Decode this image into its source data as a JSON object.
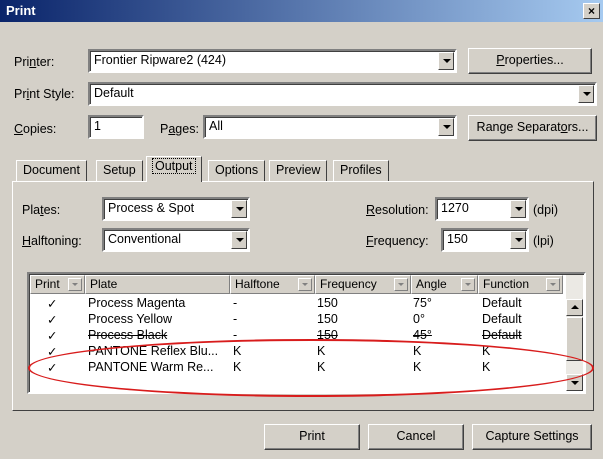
{
  "window": {
    "title": "Print",
    "close_glyph": "×"
  },
  "printer": {
    "label_pre": "Pri",
    "label_u": "n",
    "label_post": "ter:",
    "value": "Frontier Ripware2 (424)",
    "properties_pre": "",
    "properties_u": "P",
    "properties_post": "roperties..."
  },
  "print_style": {
    "label_pre": "Pr",
    "label_u": "i",
    "label_post": "nt Style:",
    "value": "Default"
  },
  "copies": {
    "label_pre": "",
    "label_u": "C",
    "label_post": "opies:",
    "value": "1"
  },
  "pages": {
    "label_pre": "P",
    "label_u": "a",
    "label_post": "ges:",
    "value": "All",
    "range_pre": "Range Separat",
    "range_u": "o",
    "range_post": "rs..."
  },
  "tabs": [
    {
      "label": "Document"
    },
    {
      "label": "Setup"
    },
    {
      "label": "Output",
      "active": true
    },
    {
      "label": "Options"
    },
    {
      "label": "Preview"
    },
    {
      "label": "Profiles"
    }
  ],
  "output": {
    "plates": {
      "label_pre": "Pla",
      "label_u": "t",
      "label_post": "es:",
      "value": "Process & Spot"
    },
    "halftoning": {
      "label_pre": "",
      "label_u": "H",
      "label_post": "alftoning:",
      "value": "Conventional"
    },
    "resolution": {
      "label_pre": "",
      "label_u": "R",
      "label_post": "esolution:",
      "value": "1270",
      "unit": "(dpi)"
    },
    "frequency": {
      "label_pre": "",
      "label_u": "F",
      "label_post": "requency:",
      "value": "150",
      "unit": "(lpi)"
    }
  },
  "table": {
    "headers": [
      "Print",
      "Plate",
      "Halftone",
      "Frequency",
      "Angle",
      "Function"
    ],
    "rows": [
      {
        "print": "✓",
        "plate": "Process Magenta",
        "halftone": "-",
        "frequency": "150",
        "angle": "75°",
        "function": "Default"
      },
      {
        "print": "✓",
        "plate": "Process Yellow",
        "halftone": "-",
        "frequency": "150",
        "angle": "0°",
        "function": "Default"
      },
      {
        "print": "✓",
        "plate": "Process Black",
        "halftone": "-",
        "frequency": "150",
        "angle": "45°",
        "function": "Default"
      },
      {
        "print": "✓",
        "plate": "PANTONE Reflex Blu...",
        "halftone": "K",
        "frequency": "K",
        "angle": "K",
        "function": "K"
      },
      {
        "print": "✓",
        "plate": "PANTONE Warm Re...",
        "halftone": "K",
        "frequency": "K",
        "angle": "K",
        "function": "K"
      }
    ]
  },
  "buttons": {
    "print": "Print",
    "cancel": "Cancel",
    "capture": "Capture Settings"
  },
  "annotation": {
    "color": "#d81c1c"
  }
}
